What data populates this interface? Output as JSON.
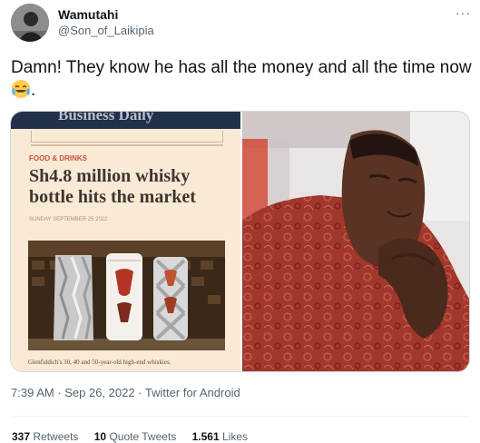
{
  "tweet": {
    "author": {
      "display_name": "Wamutahi",
      "handle": "@Son_of_Laikipia",
      "avatar_icon": "avatar-photo"
    },
    "more_label": "···",
    "text": "Damn! They know he has all the money and all the time now",
    "text_tail": ".",
    "emoji": "face-with-tears-of-joy-icon",
    "timestamp": "7:39 AM · Sep 26, 2022 · Twitter for Android",
    "stats": {
      "retweets": {
        "count": "337",
        "label": "Retweets"
      },
      "quote_tweets": {
        "count": "10",
        "label": "Quote Tweets"
      },
      "likes": {
        "count": "1.561",
        "label": "Likes"
      }
    }
  },
  "media": {
    "clipping": {
      "masthead": "Business Daily",
      "category": "FOOD & DRINKS",
      "headline": "Sh4.8 million whisky bottle hits the market",
      "dateline": "SUNDAY SEPTEMBER 25 2022",
      "caption": "Glenfiddich's 30, 40 and 50-year-old high-end whiskies."
    }
  },
  "colors": {
    "link_gray": "#536471",
    "text": "#0f1419",
    "masthead": "#22304a",
    "shirt": "#a2372c"
  }
}
